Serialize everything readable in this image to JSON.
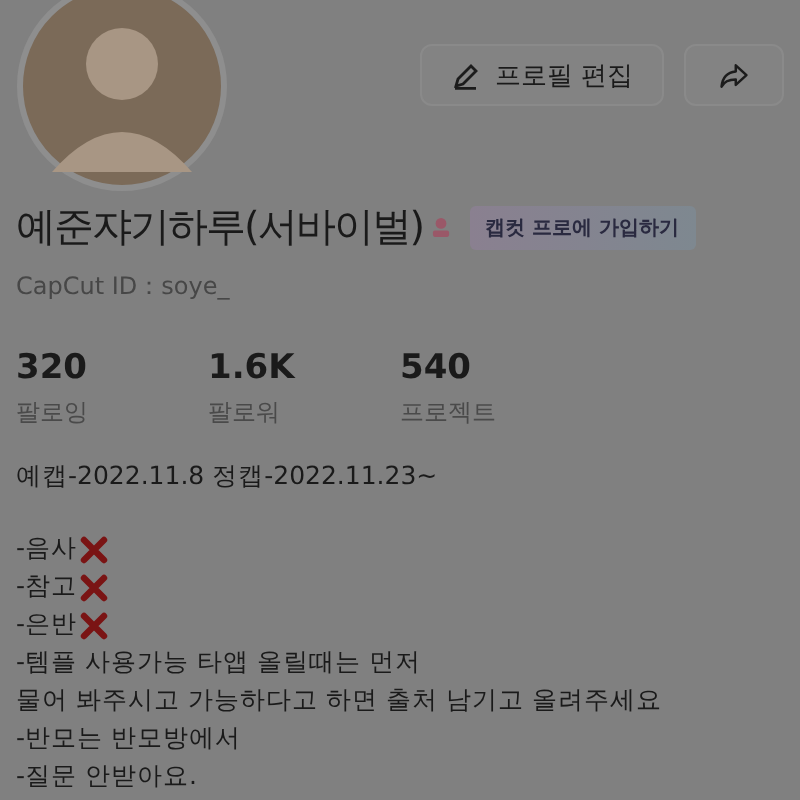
{
  "profile": {
    "name": "예준쟈기하루(서바이벌)",
    "badge": "캡컷 프로에 가입하기",
    "capcut_id": "CapCut ID：soye_"
  },
  "buttons": [
    {
      "kind": "edit",
      "label": "프로필 편집"
    },
    {
      "kind": "share"
    }
  ],
  "stats": [
    {
      "value": "320",
      "label": "팔로잉"
    },
    {
      "value": "1.6K",
      "label": "팔로워"
    },
    {
      "value": "540",
      "label": "프로젝트"
    }
  ],
  "bio": [
    {
      "text": "예캡-2022.11.8  정캡-2022.11.23~",
      "crossed": false
    },
    {
      "text": "-음사",
      "crossed": true
    },
    {
      "text": "-참고",
      "crossed": true
    },
    {
      "text": "-은반",
      "crossed": true
    },
    {
      "text": "-템플 사용가능 타앱 올릴때는 먼저",
      "crossed": false
    },
    {
      "text": "물어 봐주시고 가능하다고 하면 출처 남기고 올려주세요",
      "crossed": false
    },
    {
      "text": "-반모는 반모방에서",
      "crossed": false
    },
    {
      "text": "-질문 안받아요.",
      "crossed": false
    }
  ]
}
